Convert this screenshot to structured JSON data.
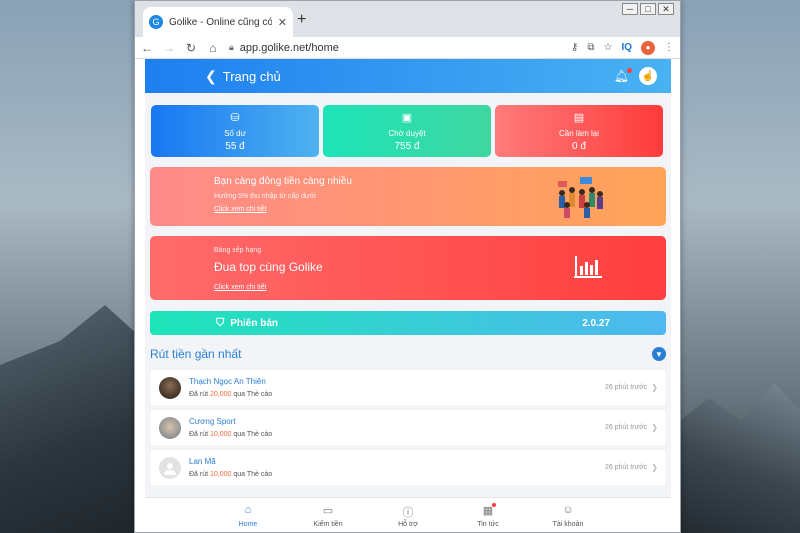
{
  "browser": {
    "tab_title": "Golike - Online cũng có thêm thu nhập",
    "tab_icon": "G",
    "close_glyph": "✕",
    "new_tab_glyph": "+",
    "url": "app.golike.net/home",
    "iq_label": "IQ",
    "window_controls": [
      "─",
      "□",
      "✕"
    ]
  },
  "app": {
    "header_title": "Trang chủ",
    "stats": [
      {
        "label": "Số dư",
        "value": "55 đ"
      },
      {
        "label": "Chờ duyệt",
        "value": "755 đ"
      },
      {
        "label": "Cần làm lại",
        "value": "0 đ"
      }
    ],
    "banner_invite": {
      "title": "Bạn càng đông tiền càng nhiều",
      "subtitle": "Hưởng 5% thu nhập từ cấp dưới",
      "link": "Click xem chi tiết"
    },
    "banner_rank": {
      "small": "Bảng xếp hạng",
      "title": "Đua top cùng Golike",
      "link": "Click xem chi tiết"
    },
    "version": {
      "label": "Phiên bản",
      "value": "2.0.27"
    },
    "withdraw_section_title": "Rút tiền gần nhất",
    "withdrawals": [
      {
        "name": "Thạch Ngọc An Thiên",
        "prefix": "Đã rút",
        "amount": "20,000",
        "suffix": "qua Thẻ cào",
        "time": "26 phút trước"
      },
      {
        "name": "Cương Sport",
        "prefix": "Đã rút",
        "amount": "10,000",
        "suffix": "qua Thẻ cào",
        "time": "26 phút trước"
      },
      {
        "name": "Lan Mã",
        "prefix": "Đã rút",
        "amount": "10,000",
        "suffix": "qua Thẻ cào",
        "time": "26 phút trước"
      }
    ],
    "bottom_nav": [
      {
        "label": "Home",
        "active": true
      },
      {
        "label": "Kiếm tiền"
      },
      {
        "label": "Hỗ trợ"
      },
      {
        "label": "Tin tức"
      },
      {
        "label": "Tài khoản"
      }
    ]
  },
  "colors": {
    "accent": "#2a7fd4",
    "amount": "#ff6a3d"
  }
}
